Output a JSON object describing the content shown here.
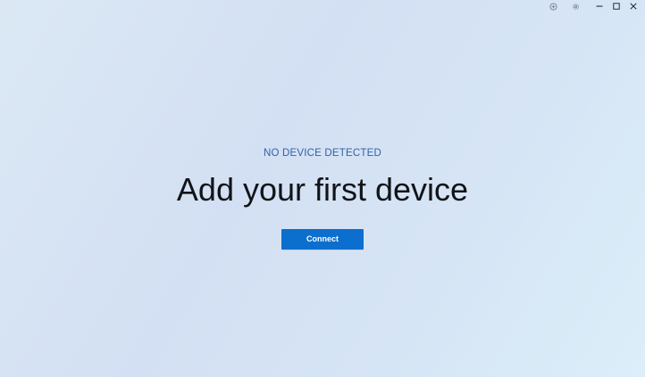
{
  "titlebar": {
    "icons": [
      "add-circle-icon",
      "gear-icon",
      "minimize-icon",
      "maximize-icon",
      "close-icon"
    ]
  },
  "main": {
    "status_label": "NO DEVICE DETECTED",
    "heading": "Add your first device",
    "connect_label": "Connect"
  },
  "colors": {
    "accent": "#0c6fce",
    "status_text": "#2f63a6",
    "heading_text": "#111418",
    "background_start": "#dbe8f4",
    "background_end": "#dbeef9"
  }
}
